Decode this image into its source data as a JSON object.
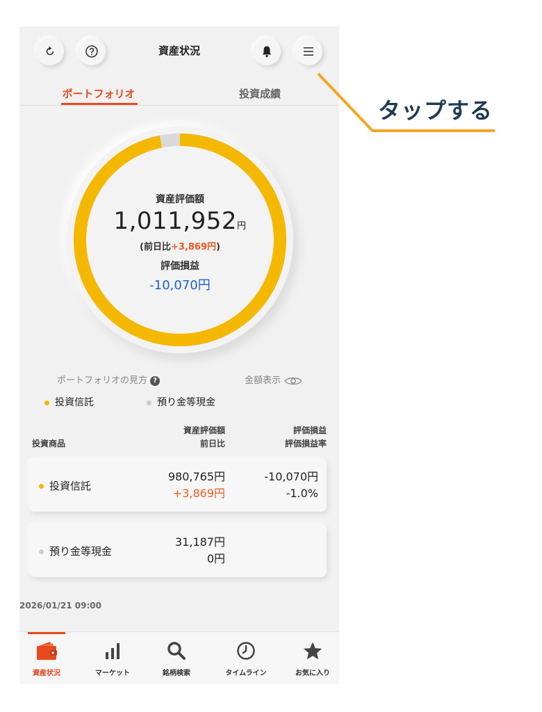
{
  "header": {
    "title": "資産状況",
    "refresh_icon": "refresh-icon",
    "help_icon": "help-icon",
    "bell_icon": "bell-icon",
    "menu_icon": "menu-icon"
  },
  "tabs": [
    {
      "label": "ポートフォリオ",
      "active": true
    },
    {
      "label": "投資成績",
      "active": false
    }
  ],
  "summary": {
    "total_label": "資産評価額",
    "total_value": "1,011,952",
    "total_unit": "円",
    "diff_prefix": "(前日比",
    "diff_value": "+3,869円",
    "diff_suffix": ")",
    "pl_label": "評価損益",
    "pl_value": "-10,070円"
  },
  "allocation": {
    "investment_trust_fraction": 0.969,
    "cash_fraction": 0.031,
    "investment_color": "#f5b800",
    "cash_color": "#d9d9d9"
  },
  "portfolio_help": "ポートフォリオの見方",
  "amount_toggle": "金額表示",
  "legend": [
    {
      "label": "投資信託",
      "color": "#f5b800"
    },
    {
      "label": "預り金等現金",
      "color": "#cccccc"
    }
  ],
  "table": {
    "headers": {
      "product": "投資商品",
      "value_line1": "資産評価額",
      "value_line2": "前日比",
      "pl_line1": "評価損益",
      "pl_line2": "評価損益率"
    },
    "rows": [
      {
        "name": "投資信託",
        "dot_color": "#f5b800",
        "value": "980,765円",
        "diff": "+3,869円",
        "pl": "-10,070円",
        "pl_rate": "-1.0%"
      },
      {
        "name": "預り金等現金",
        "dot_color": "#cccccc",
        "value": "31,187円",
        "diff": "0円",
        "pl": "",
        "pl_rate": ""
      }
    ]
  },
  "timestamp": "2026/01/21 09:00",
  "bottom_nav": [
    {
      "label": "資産状況",
      "icon": "wallet-icon",
      "active": true
    },
    {
      "label": "マーケット",
      "icon": "bar-chart-icon",
      "active": false
    },
    {
      "label": "銘柄検索",
      "icon": "search-icon",
      "active": false
    },
    {
      "label": "タイムライン",
      "icon": "clock-icon",
      "active": false
    },
    {
      "label": "お気に入り",
      "icon": "star-icon",
      "active": false
    }
  ],
  "annotation": {
    "text": "タップする",
    "line_color": "#f5a623",
    "text_color": "#1f3a56"
  }
}
